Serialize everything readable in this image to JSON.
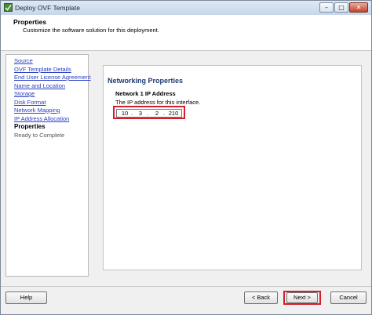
{
  "window": {
    "title": "Deploy OVF Template",
    "controls": {
      "minimize": "–",
      "maximize": "□",
      "close": "✕"
    }
  },
  "header": {
    "title": "Properties",
    "subtitle": "Customize the software solution for this deployment."
  },
  "sidebar": {
    "items": [
      {
        "label": "Source",
        "state": "link"
      },
      {
        "label": "OVF Template Details",
        "state": "link"
      },
      {
        "label": "End User License Agreement",
        "state": "link"
      },
      {
        "label": "Name and Location",
        "state": "link"
      },
      {
        "label": "Storage",
        "state": "link"
      },
      {
        "label": "Disk Format",
        "state": "link"
      },
      {
        "label": "Network Mapping",
        "state": "link"
      },
      {
        "label": "IP Address Allocation",
        "state": "link"
      },
      {
        "label": "Properties",
        "state": "current"
      },
      {
        "label": "Ready to Complete",
        "state": "pending"
      }
    ]
  },
  "main": {
    "section_title": "Networking Properties",
    "ip": {
      "label": "Network 1 IP Address",
      "description": "The IP address for this interface.",
      "octets": [
        "10",
        "3",
        "2",
        "210"
      ],
      "separator": "."
    }
  },
  "footer": {
    "help": "Help",
    "back": "< Back",
    "next": "Next >",
    "cancel": "Cancel"
  },
  "colors": {
    "highlight": "#d21f2b",
    "link": "#2a3fc1",
    "section_title": "#1f3a73"
  },
  "icons": [
    "app-icon"
  ]
}
